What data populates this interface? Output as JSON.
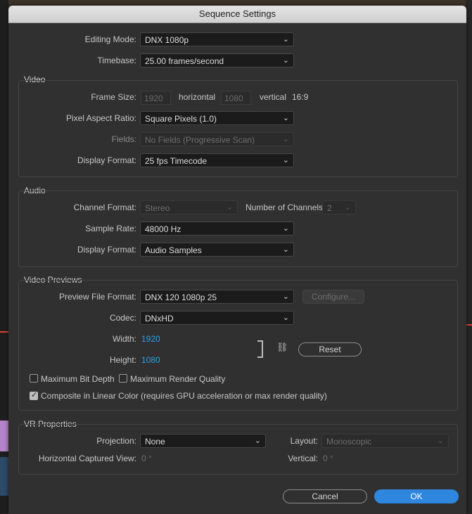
{
  "title": "Sequence Settings",
  "editing_mode": {
    "label": "Editing Mode:",
    "value": "DNX 1080p"
  },
  "timebase": {
    "label": "Timebase:",
    "value": "25.00  frames/second"
  },
  "video": {
    "title": "Video",
    "frame_size": {
      "label": "Frame Size:",
      "width": "1920",
      "horizontal": "horizontal",
      "height": "1080",
      "vertical": "vertical",
      "ratio": "16:9"
    },
    "pixel_aspect": {
      "label": "Pixel Aspect Ratio:",
      "value": "Square Pixels (1.0)"
    },
    "fields": {
      "label": "Fields:",
      "value": "No Fields (Progressive Scan)"
    },
    "display_format": {
      "label": "Display Format:",
      "value": "25 fps Timecode"
    }
  },
  "audio": {
    "title": "Audio",
    "channel_format": {
      "label": "Channel Format:",
      "value": "Stereo"
    },
    "num_channels": {
      "label": "Number of Channels:",
      "value": "2"
    },
    "sample_rate": {
      "label": "Sample Rate:",
      "value": "48000 Hz"
    },
    "display_format": {
      "label": "Display Format:",
      "value": "Audio Samples"
    }
  },
  "previews": {
    "title": "Video Previews",
    "file_format": {
      "label": "Preview File Format:",
      "value": "DNX 120 1080p 25"
    },
    "configure_label": "Configure...",
    "codec": {
      "label": "Codec:",
      "value": "DNxHD"
    },
    "width": {
      "label": "Width:",
      "value": "1920"
    },
    "height": {
      "label": "Height:",
      "value": "1080"
    },
    "reset_label": "Reset",
    "max_bit_depth": {
      "label": "Maximum Bit Depth",
      "checked": false
    },
    "max_render_quality": {
      "label": "Maximum Render Quality",
      "checked": false
    },
    "linear_color": {
      "label": "Composite in Linear Color (requires GPU acceleration or max render quality)",
      "checked": true
    }
  },
  "vr": {
    "title": "VR Properties",
    "projection": {
      "label": "Projection:",
      "value": "None"
    },
    "layout": {
      "label": "Layout:",
      "value": "Monoscopic"
    },
    "horizontal_view": {
      "label": "Horizontal Captured View:",
      "value": "0 °"
    },
    "vertical": {
      "label": "Vertical:",
      "value": "0 °"
    }
  },
  "buttons": {
    "cancel": "Cancel",
    "ok": "OK"
  },
  "colors": {
    "accent": "#2e86de",
    "link_value": "#2f9fe8",
    "dialog_bg": "#303030"
  }
}
